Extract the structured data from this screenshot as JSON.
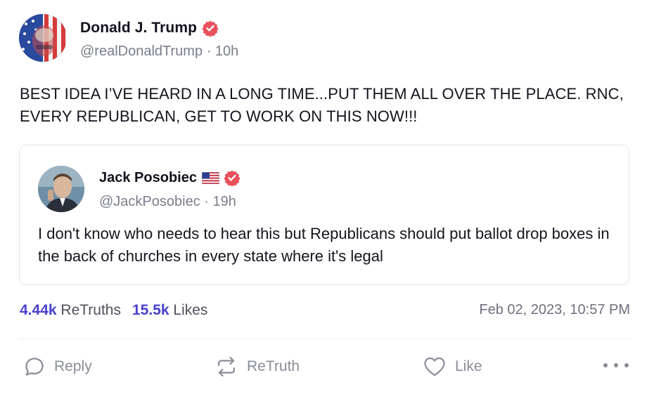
{
  "post": {
    "author": {
      "display_name": "Donald J. Trump",
      "handle": "@realDonaldTrump",
      "separator": "·",
      "age": "10h",
      "verified_icon": "verified-badge-icon"
    },
    "text": "BEST IDEA I’VE HEARD IN A LONG TIME...PUT THEM ALL OVER THE PLACE. RNC, EVERY REPUBLICAN, GET TO WORK ON THIS NOW!!!",
    "quote": {
      "author": {
        "display_name": "Jack Posobiec",
        "handle": "@JackPosobiec",
        "separator": "·",
        "age": "19h",
        "flag_icon": "us-flag-icon",
        "verified_icon": "verified-badge-icon"
      },
      "text": "I don't know who needs to hear this but Republicans should put ballot drop boxes in the back of churches in every state where it's legal"
    },
    "stats": {
      "retruths_count": "4.44k",
      "retruths_label": "ReTruths",
      "likes_count": "15.5k",
      "likes_label": "Likes"
    },
    "timestamp": "Feb 02, 2023, 10:57 PM"
  },
  "actions": {
    "reply": "Reply",
    "retruth": "ReTruth",
    "like": "Like",
    "more_icon": "more-horizontal-icon"
  },
  "colors": {
    "accent": "#4a3fd0",
    "verified": "#e8505b",
    "muted": "#7a7d8c",
    "text": "#14141f"
  }
}
